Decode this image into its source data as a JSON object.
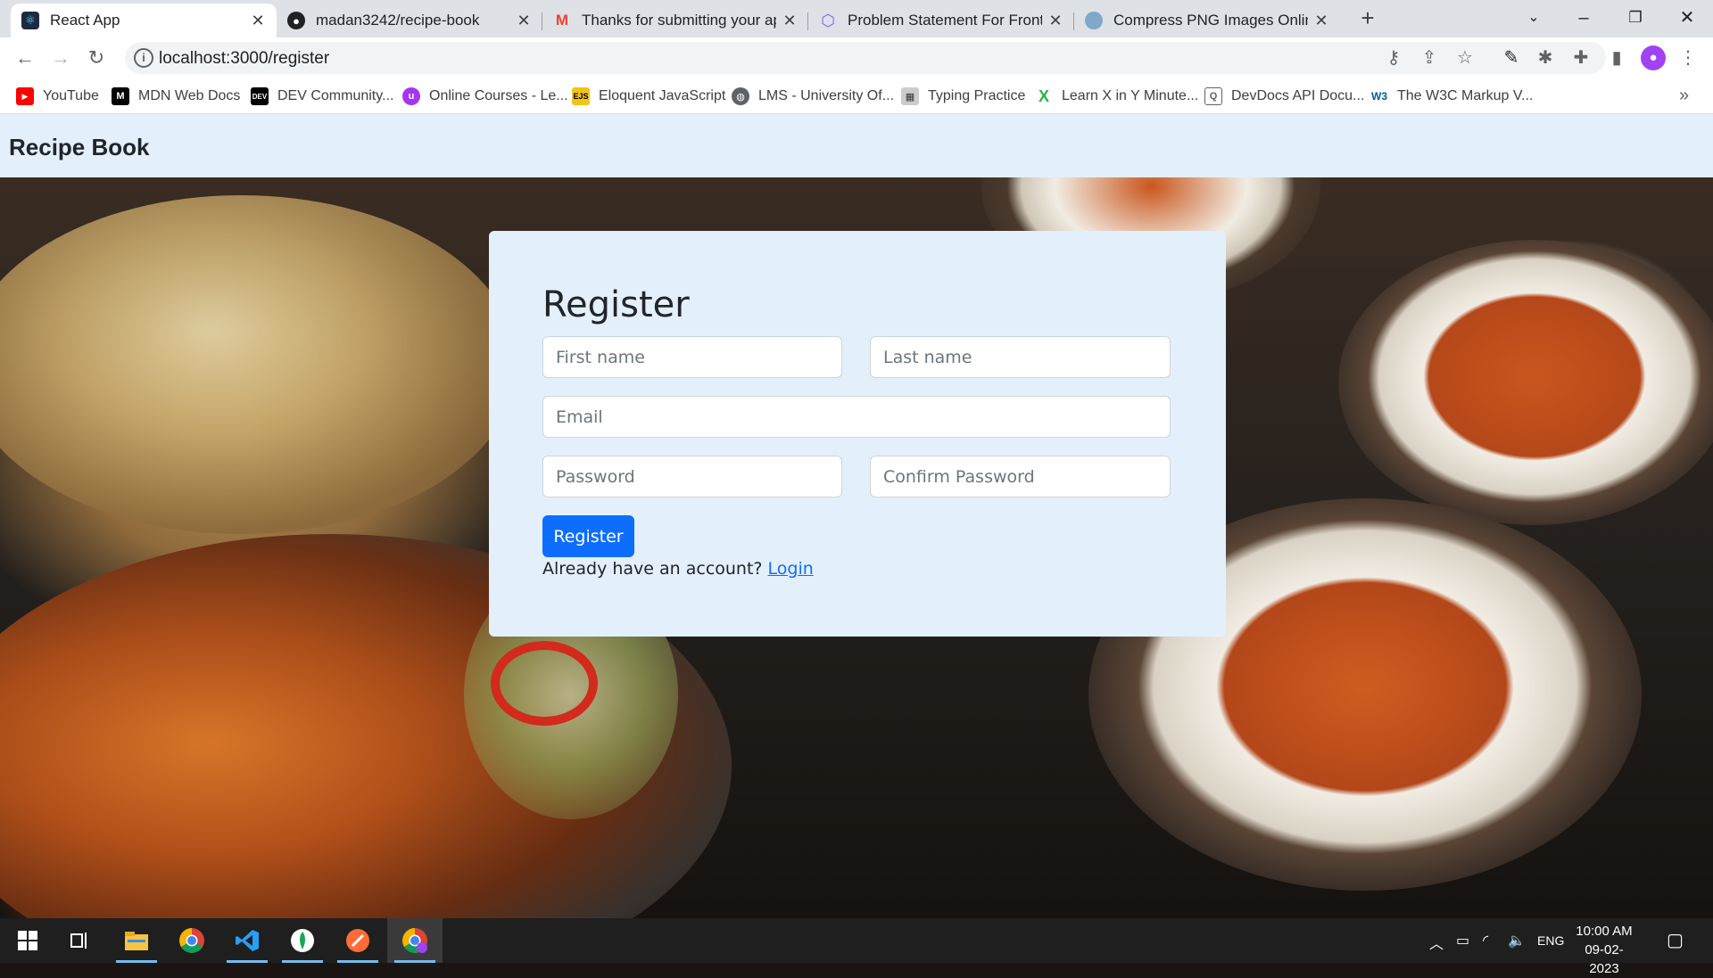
{
  "browser": {
    "tabs": [
      {
        "title": "React App",
        "icon": "react-icon"
      },
      {
        "title": "madan3242/recipe-book",
        "icon": "github-icon"
      },
      {
        "title": "Thanks for submitting your appli",
        "icon": "gmail-icon"
      },
      {
        "title": "Problem Statement For Frontend",
        "icon": "hexagon-icon"
      },
      {
        "title": "Compress PNG Images Online",
        "icon": "compress-icon"
      }
    ],
    "url": "localhost:3000/register",
    "bookmarks": [
      {
        "label": "YouTube",
        "icon": "youtube-icon"
      },
      {
        "label": "MDN Web Docs",
        "icon": "mdn-icon"
      },
      {
        "label": "DEV Community...",
        "icon": "dev-icon"
      },
      {
        "label": "Online Courses - Le...",
        "icon": "udemy-icon"
      },
      {
        "label": "Eloquent JavaScript",
        "icon": "ejs-icon"
      },
      {
        "label": "LMS - University Of...",
        "icon": "globe-icon"
      },
      {
        "label": "Typing Practice",
        "icon": "typing-icon"
      },
      {
        "label": "Learn X in Y Minute...",
        "icon": "x-icon"
      },
      {
        "label": "DevDocs API Docu...",
        "icon": "devdocs-icon"
      },
      {
        "label": "The W3C Markup V...",
        "icon": "w3c-icon"
      }
    ]
  },
  "page": {
    "brand": "Recipe Book",
    "form": {
      "heading": "Register",
      "first_name_placeholder": "First name",
      "last_name_placeholder": "Last name",
      "email_placeholder": "Email",
      "password_placeholder": "Password",
      "confirm_password_placeholder": "Confirm Password",
      "submit_label": "Register",
      "already_text": "Already have an account?",
      "login_link": "Login"
    }
  },
  "taskbar": {
    "language": "ENG",
    "time": "10:00 AM",
    "date": "09-02-2023"
  },
  "colors": {
    "primary": "#0d6efd",
    "navbar_bg": "#e3f0fc",
    "card_bg": "#e3f0fc"
  }
}
